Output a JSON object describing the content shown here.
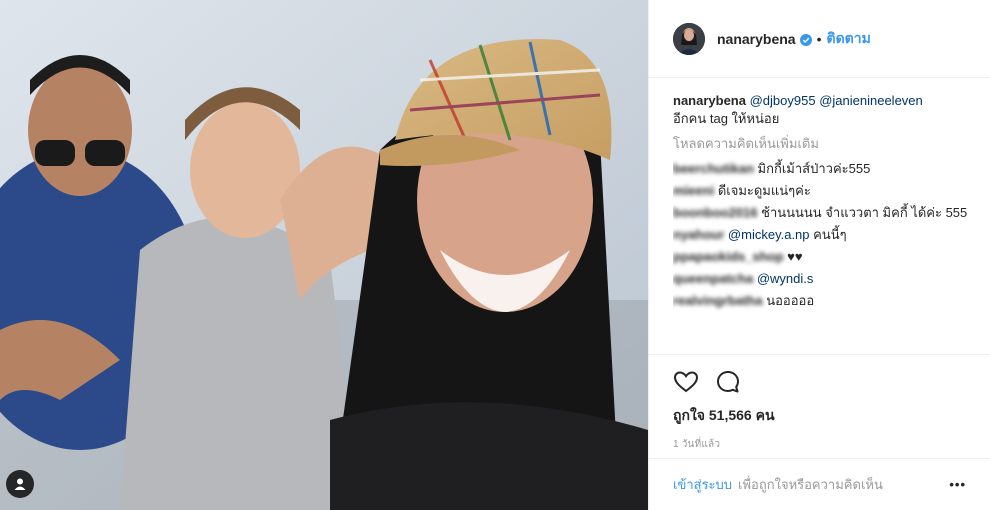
{
  "post": {
    "username": "nanarybena",
    "separator": "•",
    "follow_label": "ติดตาม",
    "caption_user": "nanarybena",
    "caption_mentions": [
      "@djboy955",
      "@janienineeleven"
    ],
    "caption_line2": "อีกคน tag ให้หน่อย",
    "load_more": "โหลดความคิดเห็นเพิ่มเติม",
    "comments": [
      {
        "user": "beerchutikan",
        "text": "มิกกี้เม้าส์ป่าวค่ะ555"
      },
      {
        "user": "mieeni",
        "text": "ดีเจมะดูมแน่ๆค่ะ"
      },
      {
        "user": "boonboo2016",
        "text": "ช้านนนนน จำแววตา มิคกี้ ได้ค่ะ 555"
      },
      {
        "user": "nyahour",
        "mention": "@mickey.a.np",
        "text": "คนนี้ๆ"
      },
      {
        "user": "ppapaokids_shop",
        "text": "♥♥"
      },
      {
        "user": "queenpatcha",
        "mention": "@wyndi.s",
        "text": ""
      },
      {
        "user": "realvingrbatha",
        "text": "นอออออ"
      }
    ],
    "likes": "ถูกใจ 51,566 คน",
    "time": "1 วันที่แล้ว",
    "login_link": "เข้าสู่ระบบ",
    "login_text": "เพื่อถูกใจหรือความคิดเห็น",
    "more": "•••"
  },
  "icons": {
    "verified": "verified-badge-icon",
    "heart": "heart-icon",
    "comment": "comment-icon",
    "user_tag": "user-tag-icon",
    "more": "more-options-icon"
  },
  "colors": {
    "link": "#3897f0",
    "mention": "#003569",
    "muted": "#999999"
  }
}
